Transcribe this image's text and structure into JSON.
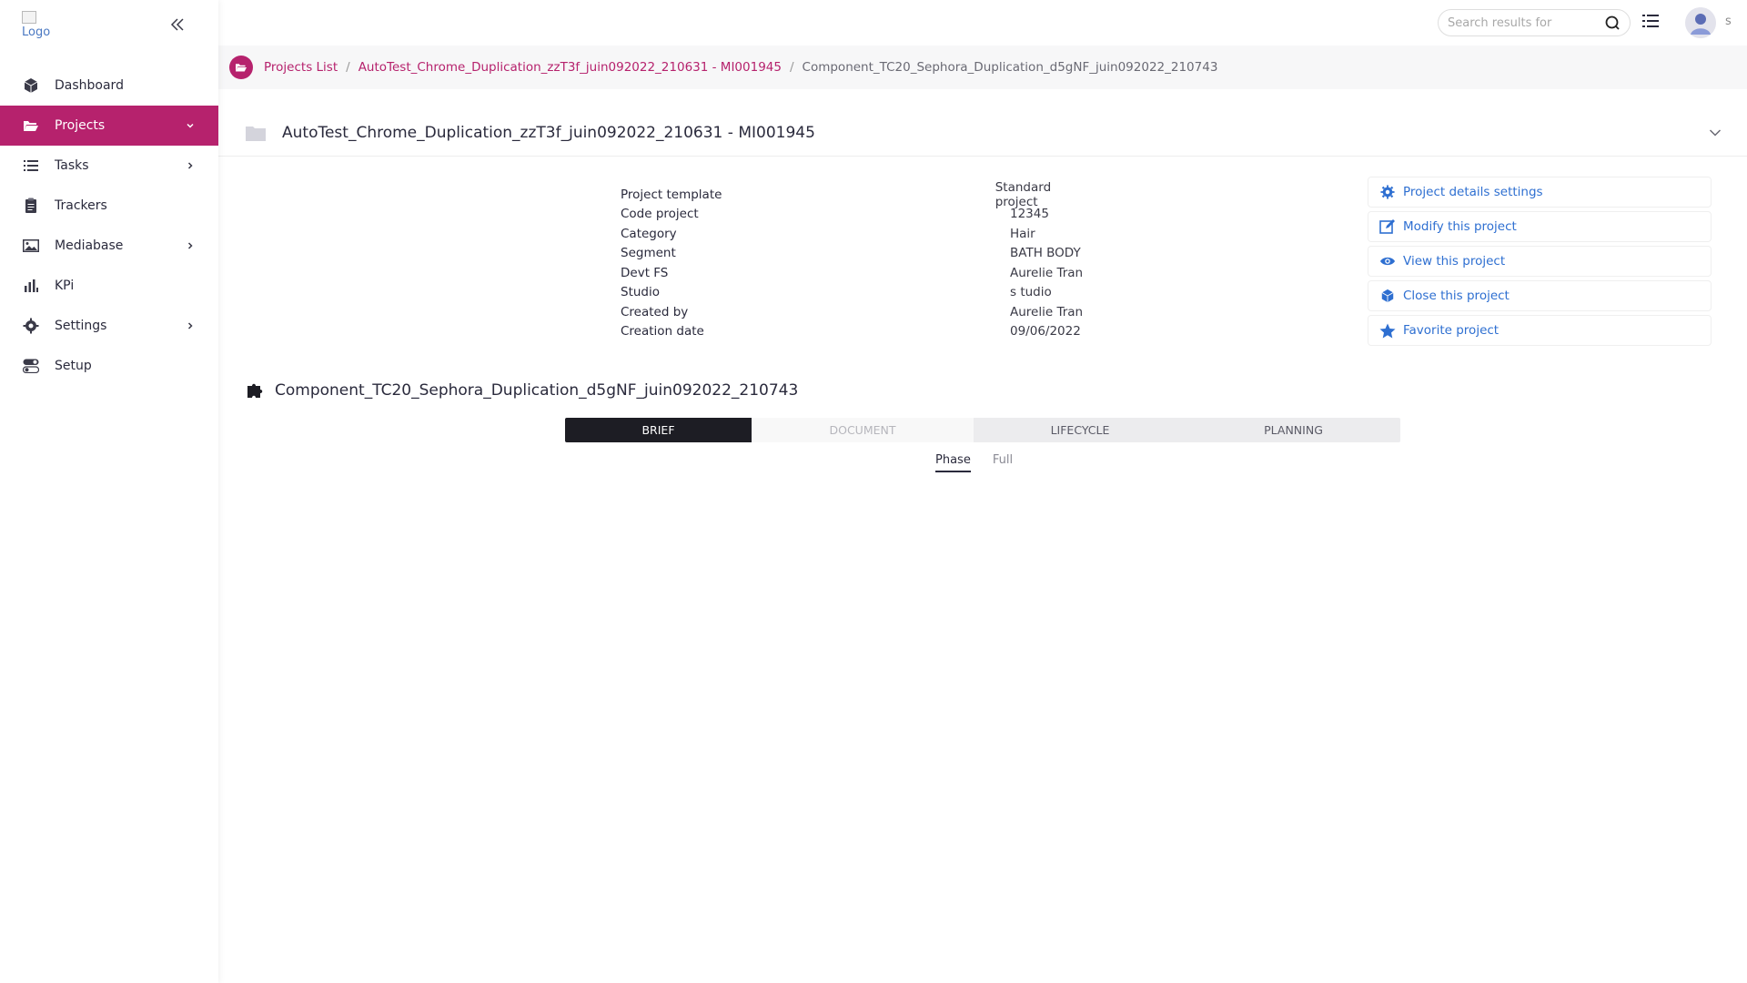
{
  "sidebar": {
    "logo_alt": "Logo",
    "items": [
      {
        "label": "Dashboard",
        "icon": "box-icon",
        "active": false,
        "has_chevron": false
      },
      {
        "label": "Projects",
        "icon": "folder-open-icon",
        "active": true,
        "has_chevron": true
      },
      {
        "label": "Tasks",
        "icon": "list-icon",
        "active": false,
        "has_chevron": true
      },
      {
        "label": "Trackers",
        "icon": "clipboard-icon",
        "active": false,
        "has_chevron": false
      },
      {
        "label": "Mediabase",
        "icon": "image-icon",
        "active": false,
        "has_chevron": true
      },
      {
        "label": "KPi",
        "icon": "bar-chart-icon",
        "active": false,
        "has_chevron": false
      },
      {
        "label": "Settings",
        "icon": "gear-icon",
        "active": false,
        "has_chevron": true
      },
      {
        "label": "Setup",
        "icon": "toggle-icon",
        "active": false,
        "has_chevron": false
      }
    ]
  },
  "topbar": {
    "search_placeholder": "Search results for",
    "user_initial": "s"
  },
  "breadcrumb": {
    "items": [
      "Projects List",
      "AutoTest_Chrome_Duplication_zzT3f_juin092022_210631 - MI001945"
    ],
    "current": "Component_TC20_Sephora_Duplication_d5gNF_juin092022_210743"
  },
  "project": {
    "title": "AutoTest_Chrome_Duplication_zzT3f_juin092022_210631 - MI001945",
    "details": [
      {
        "label": "Project template",
        "value": "Standard project"
      },
      {
        "label": "Code project",
        "value": "12345"
      },
      {
        "label": "Category",
        "value": "Hair"
      },
      {
        "label": "Segment",
        "value": "BATH BODY"
      },
      {
        "label": "Devt FS",
        "value": "Aurelie Tran"
      },
      {
        "label": "Studio",
        "value": "s tudio"
      },
      {
        "label": "Created by",
        "value": "Aurelie Tran"
      },
      {
        "label": "Creation date",
        "value": "09/06/2022"
      }
    ],
    "actions": [
      {
        "label": "Project details settings",
        "icon": "gear-icon"
      },
      {
        "label": "Modify this project",
        "icon": "edit-icon"
      },
      {
        "label": "View this project",
        "icon": "eye-icon"
      },
      {
        "label": "Close this project",
        "icon": "cube-icon"
      },
      {
        "label": "Favorite project",
        "icon": "star-icon"
      }
    ]
  },
  "component": {
    "title": "Component_TC20_Sephora_Duplication_d5gNF_juin092022_210743",
    "tabs": [
      "BRIEF",
      "DOCUMENT",
      "LIFECYCLE",
      "PLANNING"
    ],
    "active_tab": "BRIEF",
    "subtabs": [
      "Phase",
      "Full"
    ],
    "active_subtab": "Phase"
  },
  "colors": {
    "accent": "#b6226d",
    "link": "#2e6fd1",
    "dark_tab": "#1d1d24"
  }
}
